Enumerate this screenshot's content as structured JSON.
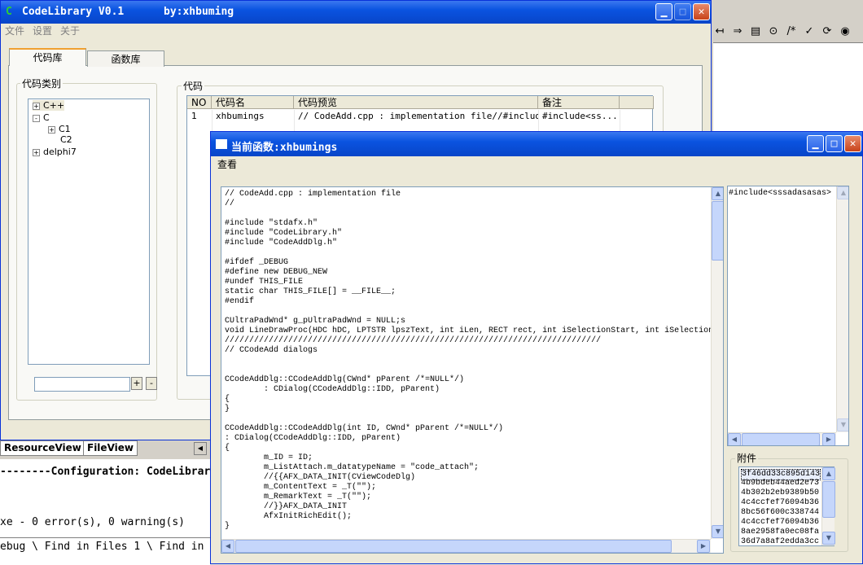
{
  "ide": {
    "toolbar_icons": [
      "back-arrow-icon",
      "forward-arrow-icon",
      "paste-icon",
      "replace-icon",
      "comment-icon",
      "spellcheck-icon",
      "refresh-icon",
      "paint-icon"
    ],
    "tab_resourceview": "ResourceView",
    "tab_fileview": "FileView",
    "output_lines": [
      "--------Configuration: CodeLibrary",
      "",
      "xe - 0 error(s), 0 warning(s)"
    ],
    "bottom_tabs": "ebug \\ Find in Files 1 \\ Find in Fi"
  },
  "win1": {
    "title": "CodeLibrary V0.1",
    "author": "by:xhbuming",
    "menu": [
      "文件",
      "设置",
      "关于"
    ],
    "tabs": [
      "代码库",
      "函数库"
    ],
    "category_group": "代码类别",
    "tree": [
      {
        "label": "C++",
        "expander": "+"
      },
      {
        "label": "C",
        "expander": "-"
      },
      {
        "label": "C1",
        "expander": "+"
      },
      {
        "label": "C2",
        "expander": ""
      },
      {
        "label": "delphi7",
        "expander": "+"
      }
    ],
    "add_label": "+",
    "remove_label": "-",
    "code_group": "代码",
    "columns": [
      "NO",
      "代码名",
      "代码预览",
      "备注"
    ],
    "rows": [
      {
        "no": "1",
        "name": "xhbumings",
        "preview": "// CodeAdd.cpp : implementation file//#includ...",
        "remark": "#include<ss..."
      }
    ]
  },
  "win2": {
    "title": "当前函数:xhbumings",
    "menu": [
      "查看"
    ],
    "code_lines": [
      "// CodeAdd.cpp : implementation file",
      "//",
      "",
      "#include \"stdafx.h\"",
      "#include \"CodeLibrary.h\"",
      "#include \"CodeAddDlg.h\"",
      "",
      "#ifdef _DEBUG",
      "#define new DEBUG_NEW",
      "#undef THIS_FILE",
      "static char THIS_FILE[] = __FILE__;",
      "#endif",
      "",
      "CUltraPadWnd* g_pUltraPadWnd = NULL;s",
      "void LineDrawProc(HDC hDC, LPTSTR lpszText, int iLen, RECT rect, int iSelectionStart, int iSelection",
      "/////////////////////////////////////////////////////////////////////////////",
      "// CCodeAdd dialogs",
      "",
      "",
      "CCodeAddDlg::CCodeAddDlg(CWnd* pParent /*=NULL*/)",
      "        : CDialog(CCodeAddDlg::IDD, pParent)",
      "{",
      "}",
      "",
      "CCodeAddDlg::CCodeAddDlg(int ID, CWnd* pParent /*=NULL*/)",
      ": CDialog(CCodeAddDlg::IDD, pParent)",
      "{",
      "        m_ID = ID;",
      "        m_ListAttach.m_datatypeName = \"code_attach\";",
      "        //{{AFX_DATA_INIT(CViewCodeDlg)",
      "        m_ContentText = _T(\"\");",
      "        m_RemarkText = _T(\"\");",
      "        //}}AFX_DATA_INIT",
      "        AfxInitRichEdit();",
      "}"
    ],
    "remark_text": "#include<sssadasasas>",
    "attach_label": "附件",
    "attachments": [
      "3f46dd33c895d143",
      "4b9bdeb44aed2e73",
      "4b302b2eb9389b50",
      "4c4ccfef76094b36",
      "8bc56f600c338744",
      "4c4ccfef76094b36",
      "8ae2958fa0ec08fa",
      "36d7a8af2edda3cc"
    ]
  }
}
